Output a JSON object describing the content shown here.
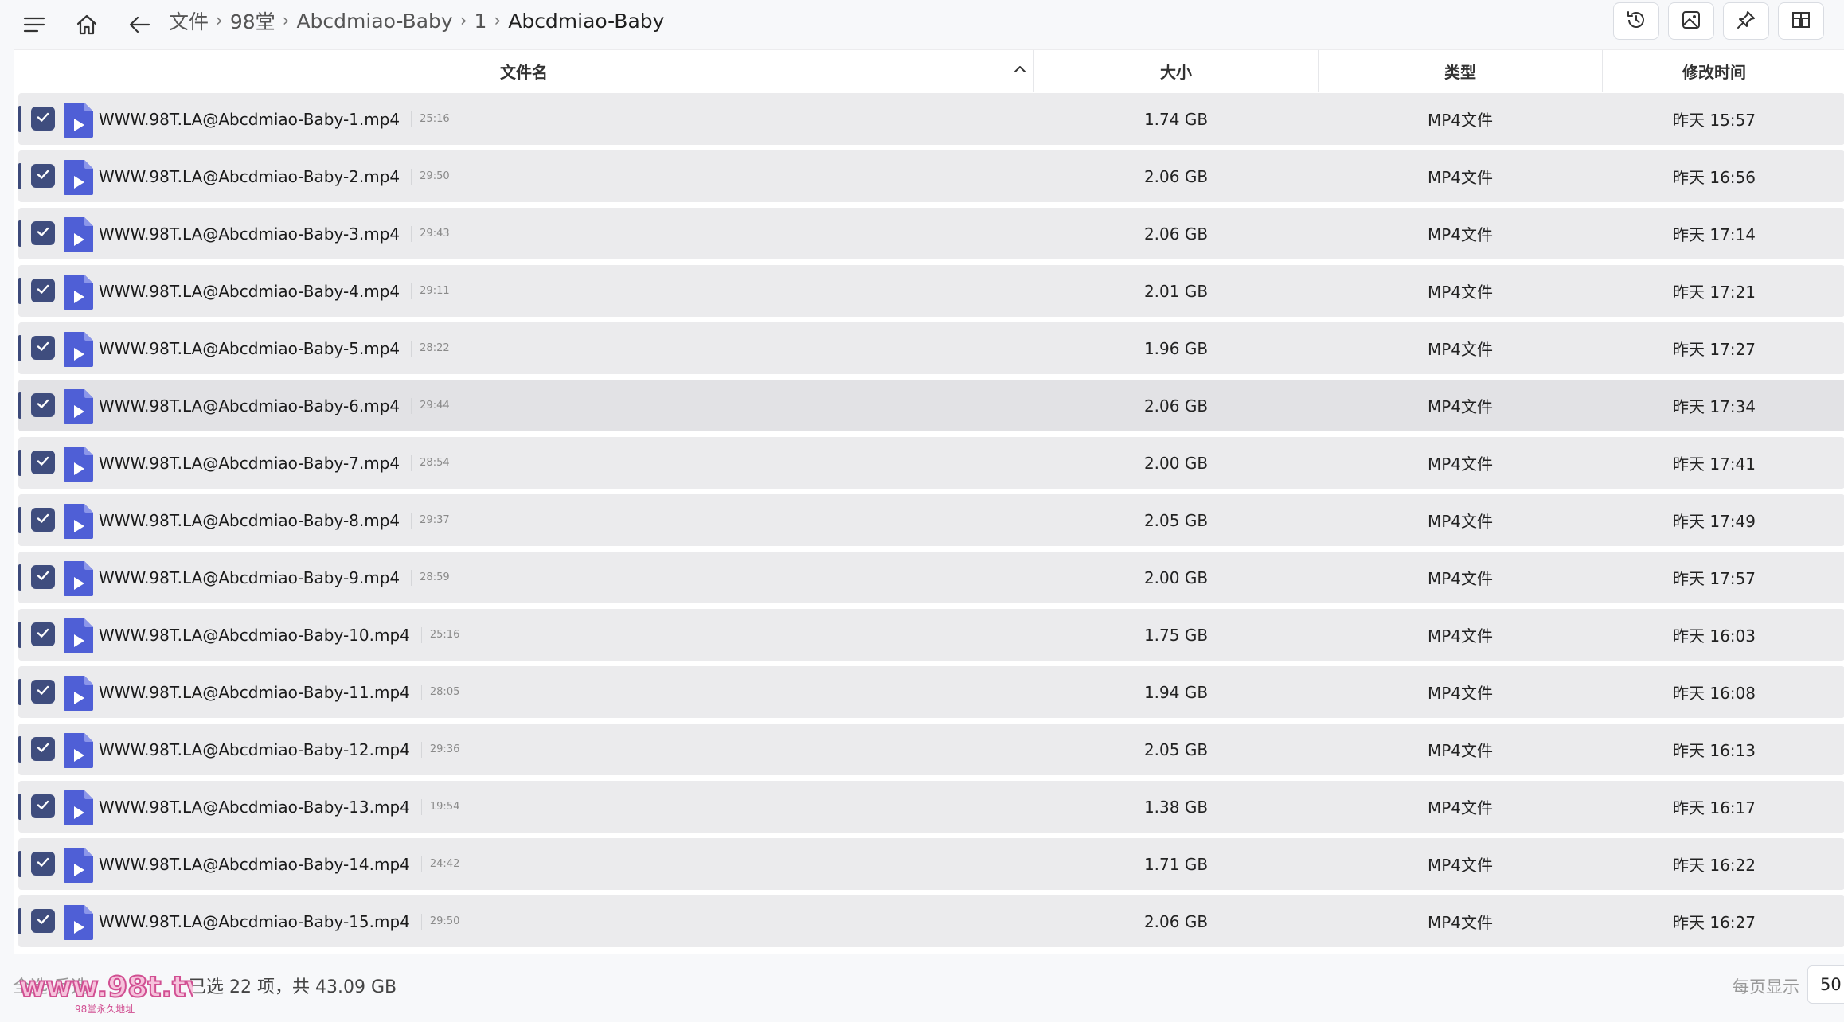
{
  "breadcrumb": [
    "文件",
    "98堂",
    "Abcdmiao-Baby",
    "1",
    "Abcdmiao-Baby"
  ],
  "columns": {
    "name": "文件名",
    "size": "大小",
    "type": "类型",
    "modified": "修改时间"
  },
  "files": [
    {
      "name": "WWW.98T.LA@Abcdmiao-Baby-1.mp4",
      "duration": "25:16",
      "size": "1.74 GB",
      "type": "MP4文件",
      "modified": "昨天 15:57"
    },
    {
      "name": "WWW.98T.LA@Abcdmiao-Baby-2.mp4",
      "duration": "29:50",
      "size": "2.06 GB",
      "type": "MP4文件",
      "modified": "昨天 16:56"
    },
    {
      "name": "WWW.98T.LA@Abcdmiao-Baby-3.mp4",
      "duration": "29:43",
      "size": "2.06 GB",
      "type": "MP4文件",
      "modified": "昨天 17:14"
    },
    {
      "name": "WWW.98T.LA@Abcdmiao-Baby-4.mp4",
      "duration": "29:11",
      "size": "2.01 GB",
      "type": "MP4文件",
      "modified": "昨天 17:21"
    },
    {
      "name": "WWW.98T.LA@Abcdmiao-Baby-5.mp4",
      "duration": "28:22",
      "size": "1.96 GB",
      "type": "MP4文件",
      "modified": "昨天 17:27"
    },
    {
      "name": "WWW.98T.LA@Abcdmiao-Baby-6.mp4",
      "duration": "29:44",
      "size": "2.06 GB",
      "type": "MP4文件",
      "modified": "昨天 17:34"
    },
    {
      "name": "WWW.98T.LA@Abcdmiao-Baby-7.mp4",
      "duration": "28:54",
      "size": "2.00 GB",
      "type": "MP4文件",
      "modified": "昨天 17:41"
    },
    {
      "name": "WWW.98T.LA@Abcdmiao-Baby-8.mp4",
      "duration": "29:37",
      "size": "2.05 GB",
      "type": "MP4文件",
      "modified": "昨天 17:49"
    },
    {
      "name": "WWW.98T.LA@Abcdmiao-Baby-9.mp4",
      "duration": "28:59",
      "size": "2.00 GB",
      "type": "MP4文件",
      "modified": "昨天 17:57"
    },
    {
      "name": "WWW.98T.LA@Abcdmiao-Baby-10.mp4",
      "duration": "25:16",
      "size": "1.75 GB",
      "type": "MP4文件",
      "modified": "昨天 16:03"
    },
    {
      "name": "WWW.98T.LA@Abcdmiao-Baby-11.mp4",
      "duration": "28:05",
      "size": "1.94 GB",
      "type": "MP4文件",
      "modified": "昨天 16:08"
    },
    {
      "name": "WWW.98T.LA@Abcdmiao-Baby-12.mp4",
      "duration": "29:36",
      "size": "2.05 GB",
      "type": "MP4文件",
      "modified": "昨天 16:13"
    },
    {
      "name": "WWW.98T.LA@Abcdmiao-Baby-13.mp4",
      "duration": "19:54",
      "size": "1.38 GB",
      "type": "MP4文件",
      "modified": "昨天 16:17"
    },
    {
      "name": "WWW.98T.LA@Abcdmiao-Baby-14.mp4",
      "duration": "24:42",
      "size": "1.71 GB",
      "type": "MP4文件",
      "modified": "昨天 16:22"
    },
    {
      "name": "WWW.98T.LA@Abcdmiao-Baby-15.mp4",
      "duration": "29:50",
      "size": "2.06 GB",
      "type": "MP4文件",
      "modified": "昨天 16:27"
    }
  ],
  "footer": {
    "links": "全选  反选",
    "selection_summary": "已选 22 项，共 43.09 GB",
    "per_page_label": "每页显示",
    "per_page_value": "50"
  },
  "watermark": {
    "text": "www.98t.tv",
    "subtext": "98堂永久地址"
  },
  "icons": {
    "menu": "menu-icon",
    "home": "home-icon",
    "back": "back-arrow-icon",
    "history": "history-icon",
    "image": "image-icon",
    "pin": "pin-icon",
    "grid": "grid-icon",
    "sort": "chevron-up-icon",
    "check": "check-icon",
    "file": "video-file-icon"
  },
  "colors": {
    "checkbox": "#3f4d7e",
    "file_icon": "#4f5fd6",
    "row_bg": "#ebebed",
    "watermark": "#e05a9c"
  }
}
